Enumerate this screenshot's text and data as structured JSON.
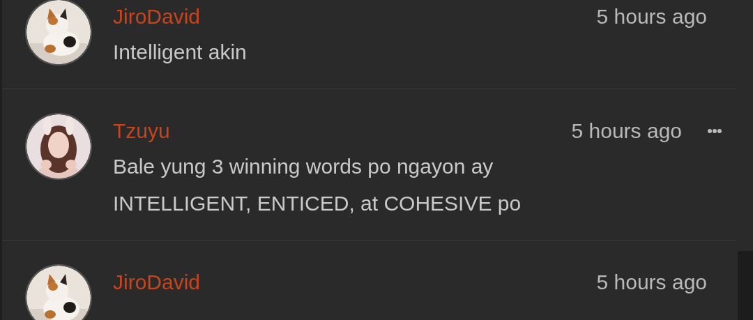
{
  "comments": [
    {
      "author": "JiroDavid",
      "time": "5 hours ago",
      "lines": [
        "Intelligent akin"
      ],
      "avatar": {
        "kind": "picture"
      },
      "menu": false
    },
    {
      "author": "Tzuyu",
      "time": "5 hours ago",
      "lines": [
        "Bale yung 3 winning words po ngayon ay",
        "INTELLIGENT, ENTICED, at COHESIVE po"
      ],
      "avatar": {
        "kind": "picture"
      },
      "menu": true
    },
    {
      "author": "JiroDavid",
      "time": "5 hours ago",
      "avatar": {
        "kind": "picture"
      },
      "menu": false
    }
  ]
}
